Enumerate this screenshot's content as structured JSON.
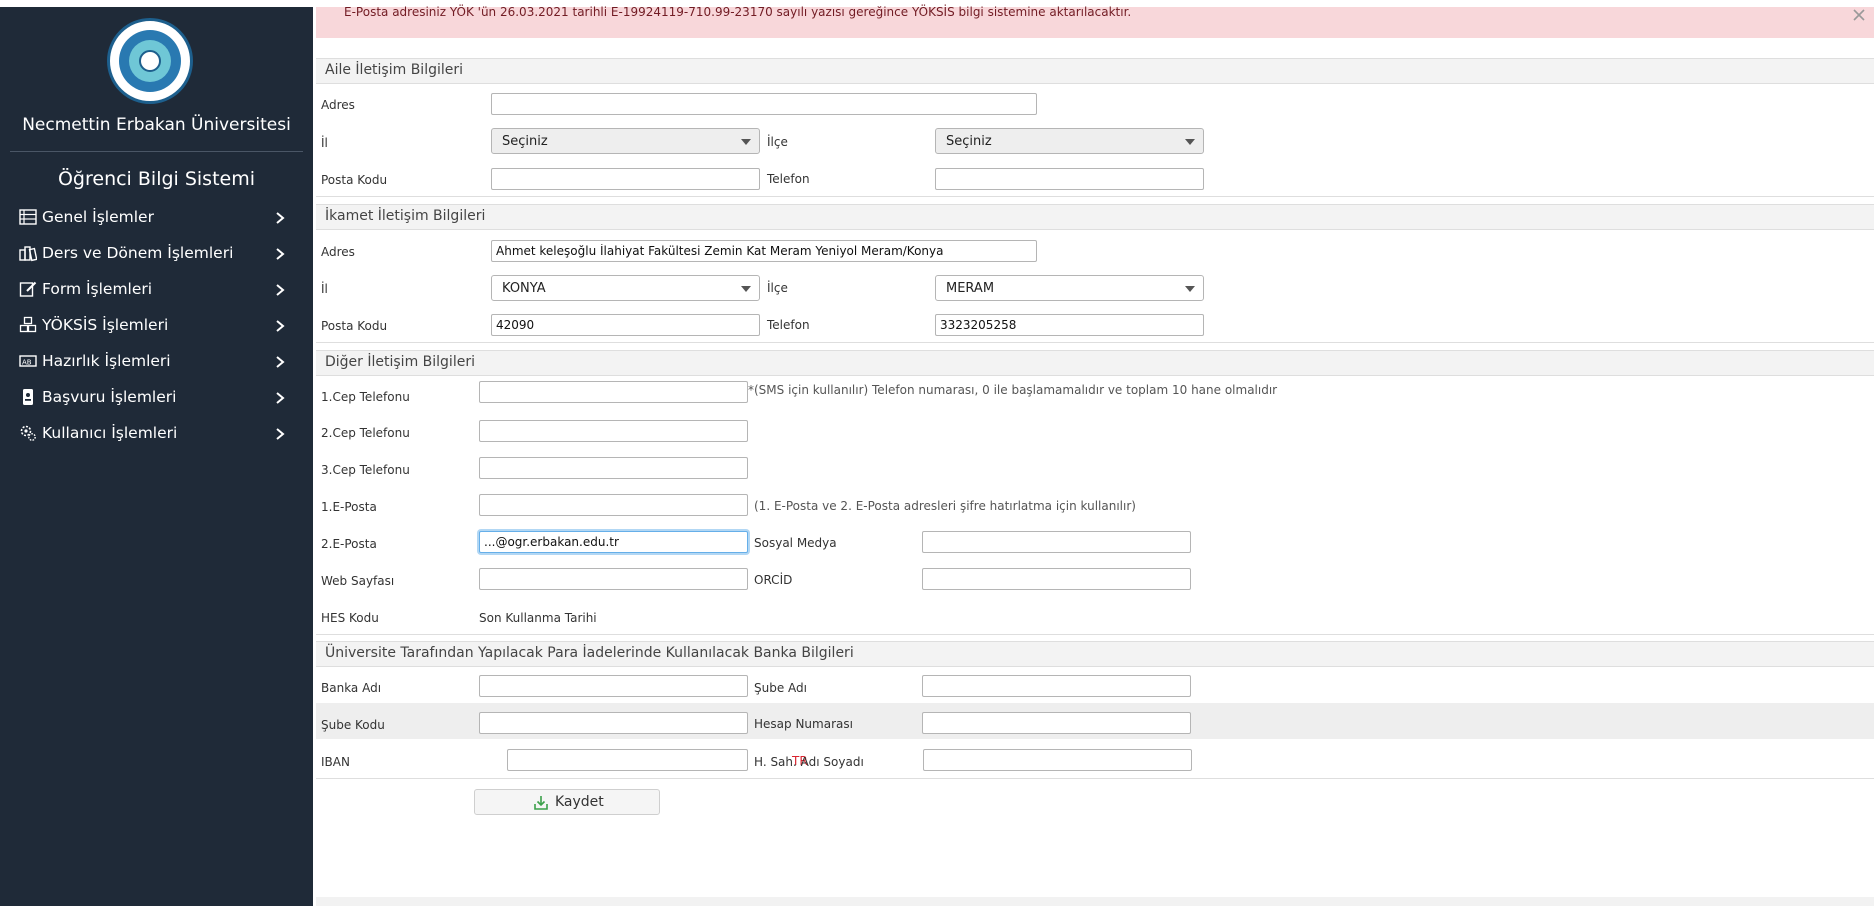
{
  "sidebar": {
    "university_name": "Necmettin Erbakan Üniversitesi",
    "system_name": "Öğrenci Bilgi Sistemi",
    "logo_name": "university-seal",
    "logo_text": "NECMETTİN ERBAKAN ÜNİVERSİTESİ",
    "items": [
      {
        "label": "Genel İşlemler",
        "icon": "list-icon"
      },
      {
        "label": "Ders ve Dönem İşlemleri",
        "icon": "books-icon"
      },
      {
        "label": "Form İşlemleri",
        "icon": "edit-icon"
      },
      {
        "label": "YÖKSİS İşlemleri",
        "icon": "cubes-icon"
      },
      {
        "label": "Hazırlık İşlemleri",
        "icon": "alphabet-icon"
      },
      {
        "label": "Başvuru İşlemleri",
        "icon": "id-badge-icon"
      },
      {
        "label": "Kullanıcı İşlemleri",
        "icon": "gears-icon"
      }
    ]
  },
  "alert": {
    "text": "E-Posta adresiniz YÖK 'ün 26.03.2021 tarihli E-19924119-710.99-23170 sayılı yazısı gereğince YÖKSİS bilgi sistemine aktarılacaktır."
  },
  "aile": {
    "title": "Aile İletişim Bilgileri",
    "adres_label": "Adres",
    "adres_value": "",
    "il_label": "İl",
    "il_value": "Seçiniz",
    "ilce_label": "İlçe",
    "ilce_value": "Seçiniz",
    "posta_label": "Posta Kodu",
    "posta_value": "",
    "telefon_label": "Telefon",
    "telefon_value": ""
  },
  "ikamet": {
    "title": "İkamet İletişim Bilgileri",
    "adres_label": "Adres",
    "adres_value": "Ahmet keleşoğlu İlahiyat Fakültesi Zemin Kat Meram Yeniyol Meram/Konya",
    "il_label": "İl",
    "il_value": "KONYA",
    "ilce_label": "İlçe",
    "ilce_value": "MERAM",
    "posta_label": "Posta Kodu",
    "posta_value": "42090",
    "telefon_label": "Telefon",
    "telefon_value": "3323205258"
  },
  "diger": {
    "title": "Diğer İletişim Bilgileri",
    "cep1_label": "1.Cep Telefonu",
    "cep1_value": "",
    "cep1_hint": "*(SMS için kullanılır) Telefon numarası, 0 ile başlamamalıdır ve toplam 10 hane olmalıdır",
    "cep2_label": "2.Cep Telefonu",
    "cep2_value": "",
    "cep3_label": "3.Cep Telefonu",
    "cep3_value": "",
    "eposta1_label": "1.E-Posta",
    "eposta1_value": "",
    "eposta_hint": "(1. E-Posta ve 2. E-Posta adresleri şifre hatırlatma için kullanılır)",
    "eposta2_label": "2.E-Posta",
    "eposta2_value": "...@ogr.erbakan.edu.tr",
    "sosyal_label": "Sosyal Medya",
    "sosyal_value": "",
    "web_label": "Web Sayfası",
    "web_value": "",
    "orcid_label": "ORCİD",
    "orcid_value": "",
    "hes_label": "HES Kodu",
    "son_kullanma_label": "Son Kullanma Tarihi"
  },
  "banka": {
    "title": "Üniversite Tarafından Yapılacak Para İadelerinde Kullanılacak Banka Bilgileri",
    "banka_adi_label": "Banka Adı",
    "banka_adi_value": "",
    "sube_adi_label": "Şube Adı",
    "sube_adi_value": "",
    "sube_kodu_label": "Şube Kodu",
    "sube_kodu_value": "",
    "hesap_label": "Hesap Numarası",
    "hesap_value": "",
    "iban_label": "IBAN",
    "iban_prefix": "TR",
    "iban_value": "",
    "hsahibi_label": "H. Sah. Adı Soyadı",
    "hsahibi_value": ""
  },
  "save_label": "Kaydet",
  "colors": {
    "sidebar_bg": "#1f2a38",
    "alert_bg": "#f8d7da",
    "alert_text": "#721c24",
    "iban_prefix": "#d9232e"
  }
}
